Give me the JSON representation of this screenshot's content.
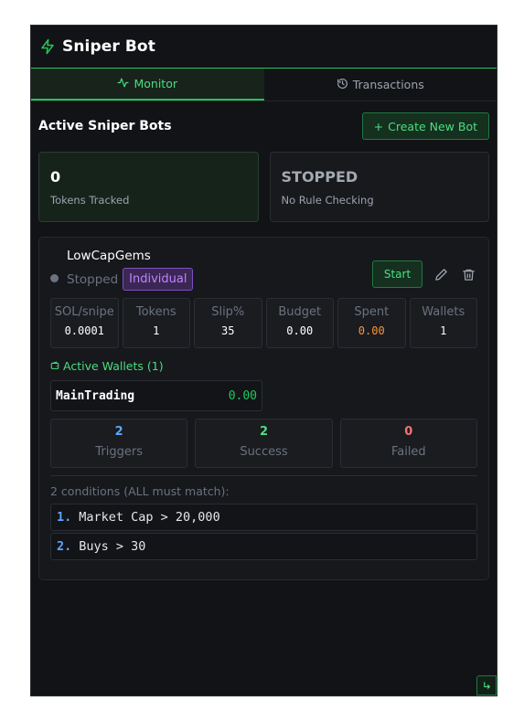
{
  "header": {
    "title": "Sniper Bot",
    "icon": "lightning-bolt-icon"
  },
  "tabs": [
    {
      "label": "Monitor",
      "icon": "activity-icon",
      "active": true
    },
    {
      "label": "Transactions",
      "icon": "history-icon",
      "active": false
    }
  ],
  "section": {
    "title": "Active Sniper Bots",
    "create_label": "Create New Bot"
  },
  "stats": [
    {
      "value": "0",
      "label": "Tokens Tracked"
    },
    {
      "value": "STOPPED",
      "label": "No Rule Checking"
    }
  ],
  "bot": {
    "name": "LowCapGems",
    "status": "Stopped",
    "mode": "Individual",
    "start_label": "Start",
    "params": [
      {
        "label": "SOL/snipe",
        "value": "0.0001"
      },
      {
        "label": "Tokens",
        "value": "1"
      },
      {
        "label": "Slip%",
        "value": "35"
      },
      {
        "label": "Budget",
        "value": "0.00"
      },
      {
        "label": "Spent",
        "value": "0.00"
      },
      {
        "label": "Wallets",
        "value": "1"
      }
    ],
    "wallets_title": "Active Wallets (1)",
    "wallet": {
      "name": "MainTrading",
      "balance": "0.00"
    },
    "counts": [
      {
        "value": "2",
        "label": "Triggers",
        "color": "#60a5fa"
      },
      {
        "value": "2",
        "label": "Success",
        "color": "#4ade80"
      },
      {
        "value": "0",
        "label": "Failed",
        "color": "#f87171"
      }
    ],
    "conditions_head": "2 conditions (ALL must match):",
    "conditions": [
      {
        "num": "1.",
        "text": "Market Cap > 20,000"
      },
      {
        "num": "2.",
        "text": "Buys > 30"
      }
    ]
  },
  "colors": {
    "accent": "#22c55e",
    "panel_bg": "#121316",
    "purple": "#c084fc",
    "orange": "#fb923c"
  }
}
